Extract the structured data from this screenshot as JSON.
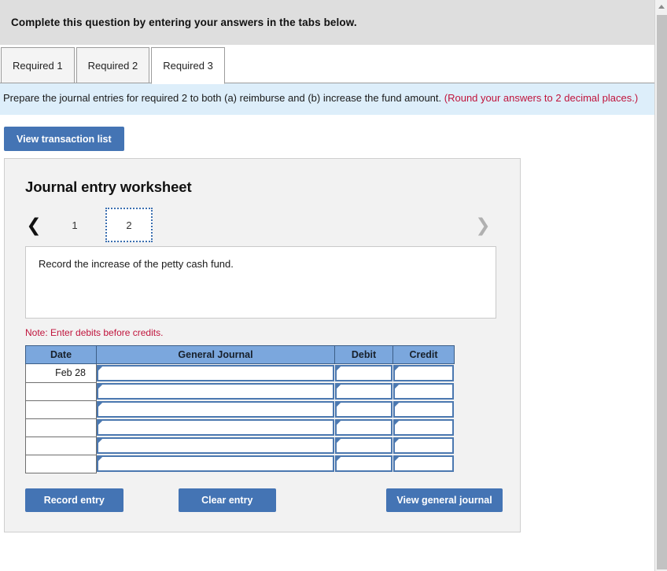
{
  "topbar": {
    "instruction": "Complete this question by entering your answers in the tabs below."
  },
  "tabs": [
    {
      "label": "Required 1",
      "active": false
    },
    {
      "label": "Required 2",
      "active": false
    },
    {
      "label": "Required 3",
      "active": true
    }
  ],
  "instruction_banner": {
    "main_text": "Prepare the journal entries for required 2 to both (a) reimburse and (b) increase the fund amount. ",
    "hint_text": "(Round your answers to 2 decimal places.)",
    "hint_color": "#c0143c",
    "background_color": "#ddeefa"
  },
  "transaction_button": {
    "label": "View transaction list"
  },
  "worksheet": {
    "title": "Journal entry worksheet",
    "pager": {
      "prev_icon": "chevron-left-icon",
      "next_icon": "chevron-right-icon",
      "pages": [
        {
          "label": "1",
          "active": false
        },
        {
          "label": "2",
          "active": true
        }
      ]
    },
    "description": "Record the increase of the petty cash fund.",
    "note": "Note: Enter debits before credits.",
    "table": {
      "headers": [
        "Date",
        "General Journal",
        "Debit",
        "Credit"
      ],
      "rows": [
        {
          "date": "Feb 28",
          "general_journal": "",
          "debit": "",
          "credit": ""
        },
        {
          "date": "",
          "general_journal": "",
          "debit": "",
          "credit": ""
        },
        {
          "date": "",
          "general_journal": "",
          "debit": "",
          "credit": ""
        },
        {
          "date": "",
          "general_journal": "",
          "debit": "",
          "credit": ""
        },
        {
          "date": "",
          "general_journal": "",
          "debit": "",
          "credit": ""
        },
        {
          "date": "",
          "general_journal": "",
          "debit": "",
          "credit": ""
        }
      ],
      "header_color": "#7ba7dd"
    },
    "actions": {
      "record_label": "Record entry",
      "clear_label": "Clear entry",
      "view_label": "View general journal",
      "button_color": "#4474b4"
    }
  },
  "scrollbar": {
    "up_arrow_icon": "scroll-up-arrow-icon"
  }
}
